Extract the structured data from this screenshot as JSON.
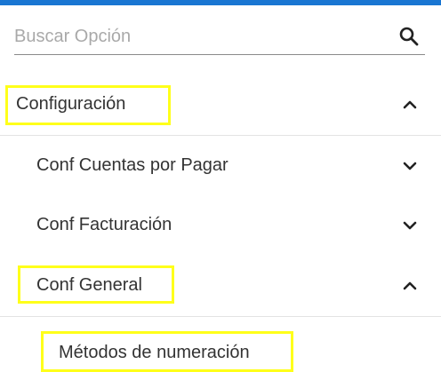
{
  "search": {
    "placeholder": "Buscar Opción",
    "value": "",
    "icon": "search-icon"
  },
  "menu": {
    "configuracion": {
      "label": "Configuración",
      "expanded": true,
      "highlighted": true,
      "children": {
        "cuentas_por_pagar": {
          "label": "Conf Cuentas por Pagar",
          "expanded": false
        },
        "facturacion": {
          "label": "Conf Facturación",
          "expanded": false
        },
        "general": {
          "label": "Conf General",
          "expanded": true,
          "highlighted": true,
          "children": {
            "metodos_numeracion": {
              "label": "Métodos de numeración",
              "highlighted": true
            }
          }
        }
      }
    }
  },
  "colors": {
    "accent": "#1976d2",
    "highlight": "#ffff1a",
    "text": "#333333",
    "placeholder": "#a9a9a9",
    "divider": "#e3e3e3"
  }
}
